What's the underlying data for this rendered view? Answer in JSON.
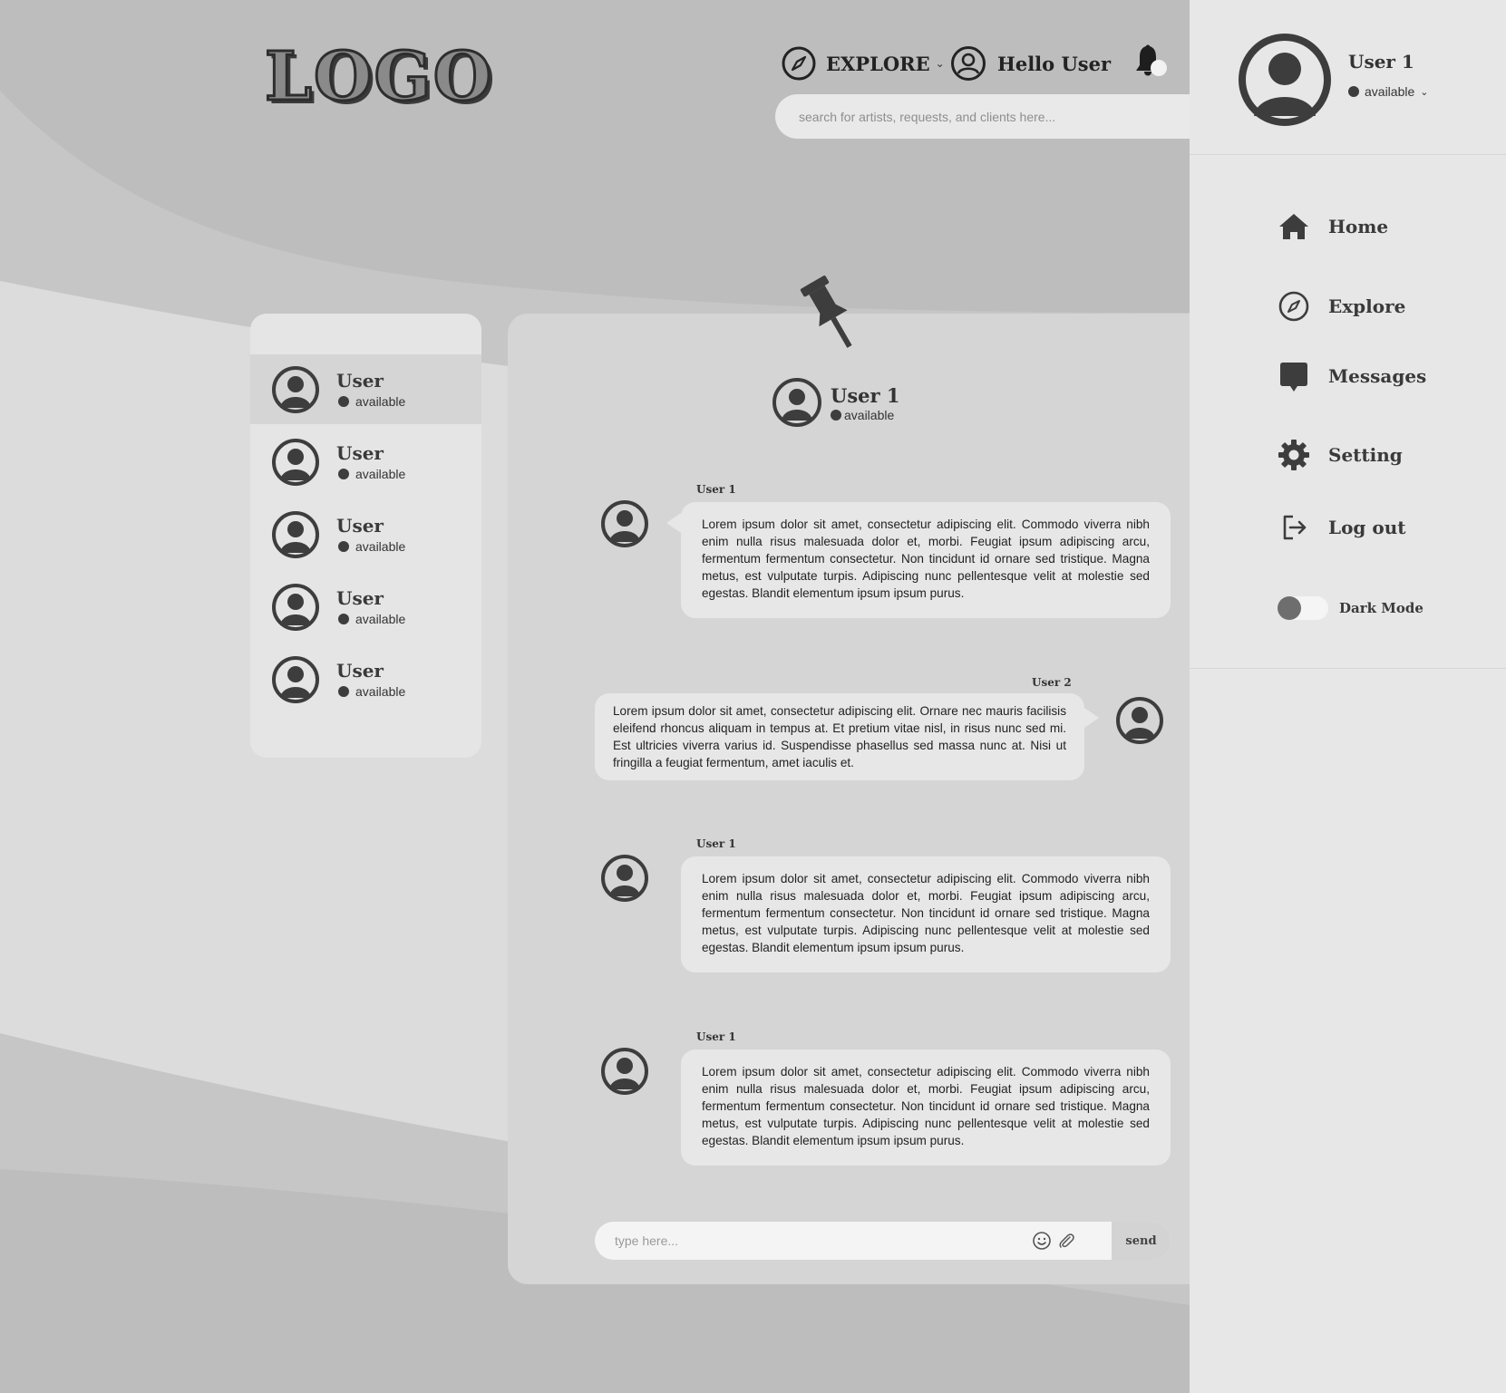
{
  "header": {
    "logo_text": "LOGO",
    "explore_label": "EXPLORE",
    "greeting": "Hello User",
    "search_placeholder": "search for artists, requests, and clients here..."
  },
  "sidebar": {
    "profile": {
      "name": "User 1",
      "status": "available"
    },
    "items": [
      {
        "label": "Home",
        "icon": "home-icon"
      },
      {
        "label": "Explore",
        "icon": "compass-icon"
      },
      {
        "label": "Messages",
        "icon": "message-icon"
      },
      {
        "label": "Setting",
        "icon": "gear-icon"
      },
      {
        "label": "Log out",
        "icon": "logout-icon"
      }
    ],
    "dark_mode_label": "Dark Mode",
    "dark_mode_on": false
  },
  "contacts": [
    {
      "name": "User",
      "status": "available",
      "active": true
    },
    {
      "name": "User",
      "status": "available",
      "active": false
    },
    {
      "name": "User",
      "status": "available",
      "active": false
    },
    {
      "name": "User",
      "status": "available",
      "active": false
    },
    {
      "name": "User",
      "status": "available",
      "active": false
    }
  ],
  "chat": {
    "header": {
      "name": "User 1",
      "status": "available"
    },
    "messages": [
      {
        "sender": "User 1",
        "side": "left",
        "text": "Lorem ipsum dolor sit amet, consectetur adipiscing elit. Commodo viverra nibh enim nulla risus malesuada dolor et, morbi. Feugiat ipsum adipiscing arcu, fermentum fermentum consectetur. Non tincidunt id ornare sed tristique. Magna metus, est vulputate turpis. Adipiscing nunc pellentesque velit at molestie sed egestas. Blandit elementum ipsum ipsum purus."
      },
      {
        "sender": "User 2",
        "side": "right",
        "text": "Lorem ipsum dolor sit amet, consectetur adipiscing elit. Ornare nec mauris facilisis eleifend rhoncus aliquam in tempus at. Et pretium vitae nisl, in risus nunc sed mi. Est ultricies viverra varius id. Suspendisse phasellus sed massa nunc at. Nisi ut fringilla a feugiat fermentum, amet iaculis et."
      },
      {
        "sender": "User 1",
        "side": "left",
        "text": "Lorem ipsum dolor sit amet, consectetur adipiscing elit. Commodo viverra nibh enim nulla risus malesuada dolor et, morbi. Feugiat ipsum adipiscing arcu, fermentum fermentum consectetur. Non tincidunt id ornare sed tristique. Magna metus, est vulputate turpis. Adipiscing nunc pellentesque velit at molestie sed egestas. Blandit elementum ipsum ipsum purus."
      },
      {
        "sender": "User 1",
        "side": "left",
        "text": "Lorem ipsum dolor sit amet, consectetur adipiscing elit. Commodo viverra nibh enim nulla risus malesuada dolor et, morbi. Feugiat ipsum adipiscing arcu, fermentum fermentum consectetur. Non tincidunt id ornare sed tristique. Magna metus, est vulputate turpis. Adipiscing nunc pellentesque velit at molestie sed egestas. Blandit elementum ipsum ipsum purus."
      }
    ],
    "composer": {
      "placeholder": "type here...",
      "send_label": "send"
    }
  },
  "colors": {
    "page_bg": "#bdbdbd",
    "panel": "#d5d5d5",
    "bubble": "#e7e7e7",
    "sidebar": "#e7e7e7",
    "ink": "#3d3d3d"
  }
}
